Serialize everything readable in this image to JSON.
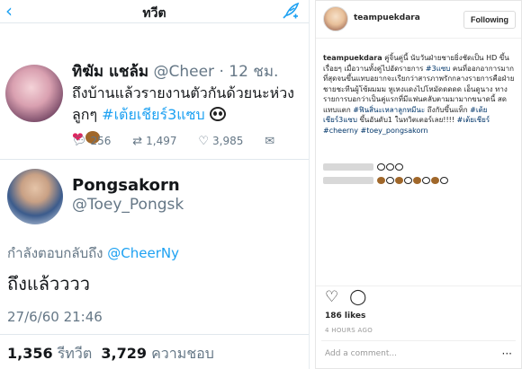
{
  "twitter": {
    "header": {
      "back_icon": "‹",
      "title": "ทวีต",
      "compose_icon": "feather-icon"
    },
    "tweet1": {
      "name": "ทิฆัม แชล้ม",
      "handle": "@Cheer",
      "time": "· 12 ชม.",
      "text_line": "ถึงบ้านแล้วรายงานตัวกันด้วยนะห่วงลูกๆ ",
      "hashtag": "#เต้ยเชียร์3แซบ",
      "stats": {
        "replies": "256",
        "retweets": "1,497",
        "likes": "3,985"
      }
    },
    "tweet2": {
      "name": "Pongsakorn",
      "handle": "@Toey_Pongsk",
      "reply_prefix": "กำลังตอบกลับถึง ",
      "reply_mention": "@CheerNy",
      "text": "ถึงแล้วววว",
      "timestamp": "27/6/60 21:46",
      "retweet_count": "1,356",
      "retweet_label": "รีทวีต",
      "like_count": "3,729",
      "like_label": "ความชอบ"
    }
  },
  "instagram": {
    "username": "teampuekdara",
    "follow_label": "Following",
    "caption_user": "teampuekdara",
    "caption_text_1": " คู่จิ้นคู่นี้ นับวันฝ่ายชายยิ่งชัดเป็น HD ขึ้นเรื่อยๆ เมื่อวานทั้งคู่ไปอัดรายการ ",
    "caption_tag_1": "#3แซบ",
    "caption_text_2": " คนที่ออกอาการมากที่สุดจนขึ้นแทบอยากจะเรียกว่าสารภาพรักกลางรายการคือฝ่ายชายชะทีนผู้โซ้ผมมม หูเหงแดงไปโหมัดดดดด เอ็นดูนาง ทางรายการบอกว่าเป็นคู่แรกที่มีแฟนคลับตามมามากขนาดนี้ สดแทบแตก ",
    "caption_tag_2": "#ฟินสิ่นะเหลาลูกหมีนะ",
    "caption_text_3": " ถึงกับขึ้นแท็ก ",
    "caption_tag_3": "#เต้ยเชียร์3แซบ",
    "caption_text_4": " ขึ้นอันดับ1 ในทวิตเตอร์เลย!!!! ",
    "caption_tag_4": "#เต้ยเชียร์ #cheerny #toey_pongsakorn",
    "likes": "186 likes",
    "time_ago": "4 HOURS AGO",
    "add_comment_placeholder": "Add a comment...",
    "more_icon": "···"
  }
}
